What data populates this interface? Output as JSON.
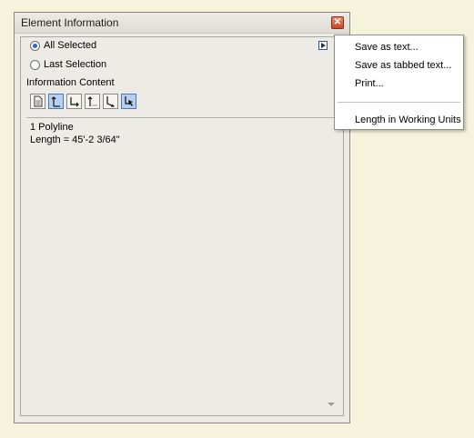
{
  "window": {
    "title": "Element Information",
    "close_symbol": "✕"
  },
  "scope": {
    "options": [
      {
        "label": "All Selected",
        "checked": true
      },
      {
        "label": "Last Selection",
        "checked": false
      }
    ]
  },
  "info_content": {
    "label": "Information Content",
    "buttons": [
      {
        "icon": "document-icon",
        "active": false
      },
      {
        "icon": "vertical-axis-icon",
        "active": true
      },
      {
        "icon": "right-angle-icon",
        "active": false
      },
      {
        "icon": "vertical-axis-disabled-icon",
        "active": false
      },
      {
        "icon": "diagonal-axis-icon",
        "active": false
      },
      {
        "icon": "cursor-select-icon",
        "active": true
      }
    ]
  },
  "content": {
    "lines": [
      "1 Polyline",
      "Length = 45'-2 3/64\""
    ]
  },
  "menu": {
    "items": [
      "Save as text...",
      "Save as tabbed text...",
      "Print..."
    ],
    "checked_item": "Length in Working Units"
  },
  "colors": {
    "background": "#f5f3dc",
    "window": "#ecebe6",
    "accent": "#2c6bc7",
    "active_button": "#b8d0ef"
  }
}
